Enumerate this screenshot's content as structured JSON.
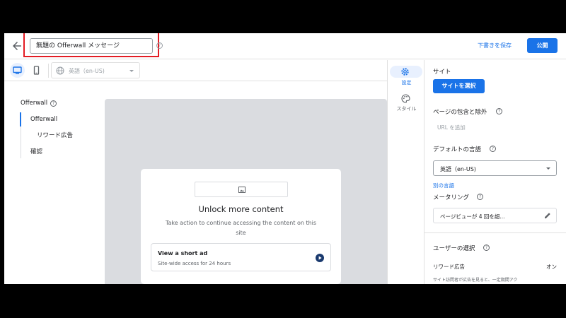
{
  "header": {
    "title_value": "無題の Offerwall メッセージ",
    "help_glyph": "?",
    "save_draft_label": "下書きを保存",
    "publish_label": "公開"
  },
  "toolbar": {
    "language_value": "英語（en-US)",
    "active_device": "desktop"
  },
  "nav": {
    "title": "Offerwall",
    "help_glyph": "?",
    "items": [
      {
        "label": "Offerwall",
        "active": true
      },
      {
        "label": "リワード広告",
        "active": false
      },
      {
        "label": "確認",
        "active": false
      }
    ]
  },
  "preview": {
    "title": "Unlock more content",
    "description": "Take action to continue accessing the content on this site",
    "option": {
      "title": "View a short ad",
      "subtitle": "Site-wide access for 24 hours"
    }
  },
  "rail": {
    "settings_label": "設定",
    "style_label": "スタイル"
  },
  "panel": {
    "site_heading": "サイト",
    "select_site_label": "サイトを選択",
    "page_include_heading": "ページの包含と除外",
    "url_add_label": "URL を追加",
    "default_lang_heading": "デフォルトの言語",
    "default_lang_value": "英語（en-US)",
    "other_lang_link": "別の言語",
    "metering_heading": "メータリング",
    "metering_value": "ページビューが 4 回を超...",
    "user_choice_heading": "ユーザーの選択",
    "reward_label": "リワード広告",
    "reward_value": "オン",
    "reward_desc": "サイト訪問者が広告を見ると、一定期間アク"
  },
  "colors": {
    "accent": "#1a73e8",
    "highlight": "#e31b23"
  }
}
